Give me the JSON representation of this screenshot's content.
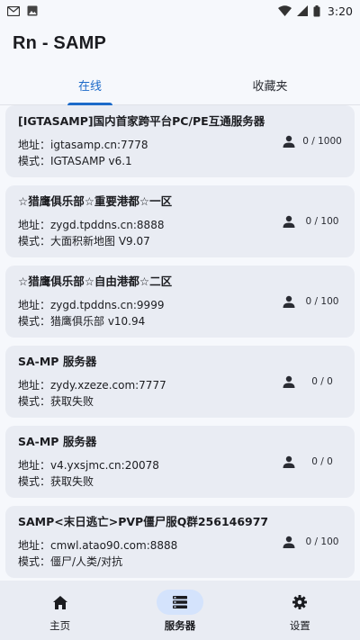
{
  "status_bar": {
    "time": "3:20",
    "icons": [
      "gmail-icon",
      "image-icon",
      "wifi-icon",
      "cellular-icon",
      "battery-icon"
    ]
  },
  "app_bar": {
    "title": "Rn - SAMP"
  },
  "tabs": [
    {
      "label": "在线",
      "active": true
    },
    {
      "label": "收藏夹",
      "active": false
    }
  ],
  "servers": [
    {
      "name": "[IGTASAMP]国内首家跨平台PC/PE互通服务器",
      "address": "地址：igtasamp.cn:7778",
      "mode": "模式：IGTASAMP v6.1",
      "players": "0 / 1000"
    },
    {
      "name": "☆猎鹰俱乐部☆重要港都☆一区",
      "address": "地址：zygd.tpddns.cn:8888",
      "mode": "模式：大面积新地图 V9.07",
      "players": "0 / 100"
    },
    {
      "name": "☆猎鹰俱乐部☆自由港都☆二区",
      "address": "地址：zygd.tpddns.cn:9999",
      "mode": "模式：猎鹰俱乐部  v10.94",
      "players": "0 / 100"
    },
    {
      "name": "SA-MP 服务器",
      "address": "地址：zydy.xzeze.com:7777",
      "mode": "模式：获取失败",
      "players": "0 / 0"
    },
    {
      "name": "SA-MP 服务器",
      "address": "地址：v4.yxsjmc.cn:20078",
      "mode": "模式：获取失败",
      "players": "0 / 0"
    },
    {
      "name": "SAMP<末日逃亡>PVP僵尸服Q群256146977",
      "address": "地址：cmwl.atao90.com:8888",
      "mode": "模式：僵尸/人类/对抗",
      "players": "0 / 100"
    }
  ],
  "bottom_nav": [
    {
      "label": "主页",
      "icon": "home-icon",
      "active": false
    },
    {
      "label": "服务器",
      "icon": "server-list-icon",
      "active": true
    },
    {
      "label": "设置",
      "icon": "gear-icon",
      "active": false
    }
  ],
  "colors": {
    "accent": "#1c6ac9",
    "card": "#e9ecf3",
    "background": "#f6f8fc",
    "nav_active_pill": "#d4e3fc"
  }
}
